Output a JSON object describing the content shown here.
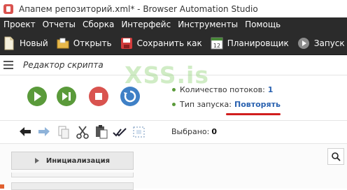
{
  "window": {
    "title": "Апапем репозиторий.xml* - Browser Automation Studio"
  },
  "menu": [
    "Проект",
    "Отчеты",
    "Сборка",
    "Интерфейс",
    "Инструменты",
    "Помощь"
  ],
  "toolbar": {
    "new_label": "Новый",
    "open_label": "Открыть",
    "save_as_label": "Сохранить как",
    "scheduler_label": "Планировщик",
    "scheduler_icon_text": "12",
    "run_label": "Запуск"
  },
  "editor": {
    "title": "Редактор скрипта",
    "threads_label": "Количество потоков:",
    "threads_value": "1",
    "run_type_label": "Тип запуска:",
    "run_type_value": "Повторять",
    "selected_label": "Выбрано:",
    "selected_value": "0",
    "init_button_label": "Инициализация"
  },
  "watermark": "XSS.is",
  "colors": {
    "dark_bar": "#2b2b2b",
    "green": "#5a9a3a",
    "red": "#d9534f",
    "blue": "#3f80c6",
    "link_blue": "#2a62b0",
    "underline_red": "#d11d1d"
  }
}
